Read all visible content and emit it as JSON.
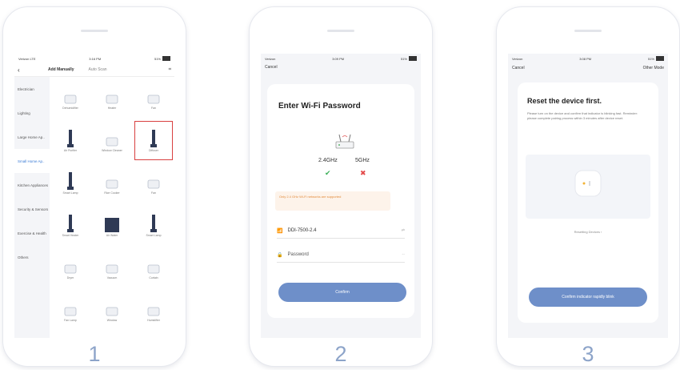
{
  "steps": [
    "1",
    "2",
    "3"
  ],
  "phone1": {
    "status": {
      "carrier": "Verizon LTE",
      "time": "3:16 PM",
      "battery": "51%"
    },
    "header": {
      "back": "‹",
      "tab_manual": "Add Manually",
      "tab_auto": "Auto Scan",
      "scan_icon": "scan-icon"
    },
    "sidebar": [
      "Electrician",
      "Lighting",
      "Large Home Ap..",
      "Small Home Ap..",
      "Kitchen Appliances",
      "Security & Sensors",
      "Exercise & Health",
      "Others"
    ],
    "grid": [
      "Dehumidifier",
      "Heater",
      "Fan",
      "Air Purifier",
      "Window Cleaner",
      "Diffuser",
      "Smart Lamp",
      "Rice Cooker",
      "Fan",
      "Smart Heater",
      "Air Water",
      "Smart Lamp",
      "Dryer",
      "Vacuum",
      "Curtain",
      "Fan Lamp",
      "Window",
      "Humidifier"
    ],
    "selected_index": 5
  },
  "phone2": {
    "status": {
      "carrier": "Verizon",
      "time": "3:09 PM",
      "battery": "51%"
    },
    "cancel": "Cancel",
    "title": "Enter Wi-Fi Password",
    "band_24": "2.4GHz",
    "band_5": "5GHz",
    "note": "Only 2.4 GHz Wi-Fi networks are supported",
    "ssid": "DDI-7500-2.4",
    "password_placeholder": "Password",
    "confirm": "Confirm"
  },
  "phone3": {
    "status": {
      "carrier": "Verizon",
      "time": "3:08 PM",
      "battery": "51%"
    },
    "cancel": "Cancel",
    "other_mode": "Other Mode",
    "title": "Reset the device first.",
    "text": "Please turn on the device and confirm that indicator is blinking fast. Reminder: please complete pairing process within 3 minutes after device reset.",
    "help": "Resetting Devices ›",
    "confirm": "Confirm indicator rapidly blink"
  },
  "colors": {
    "accent": "#6e8fc9",
    "step": "#8da4c9",
    "highlight": "#d94040",
    "warning": "#e28a3a"
  }
}
